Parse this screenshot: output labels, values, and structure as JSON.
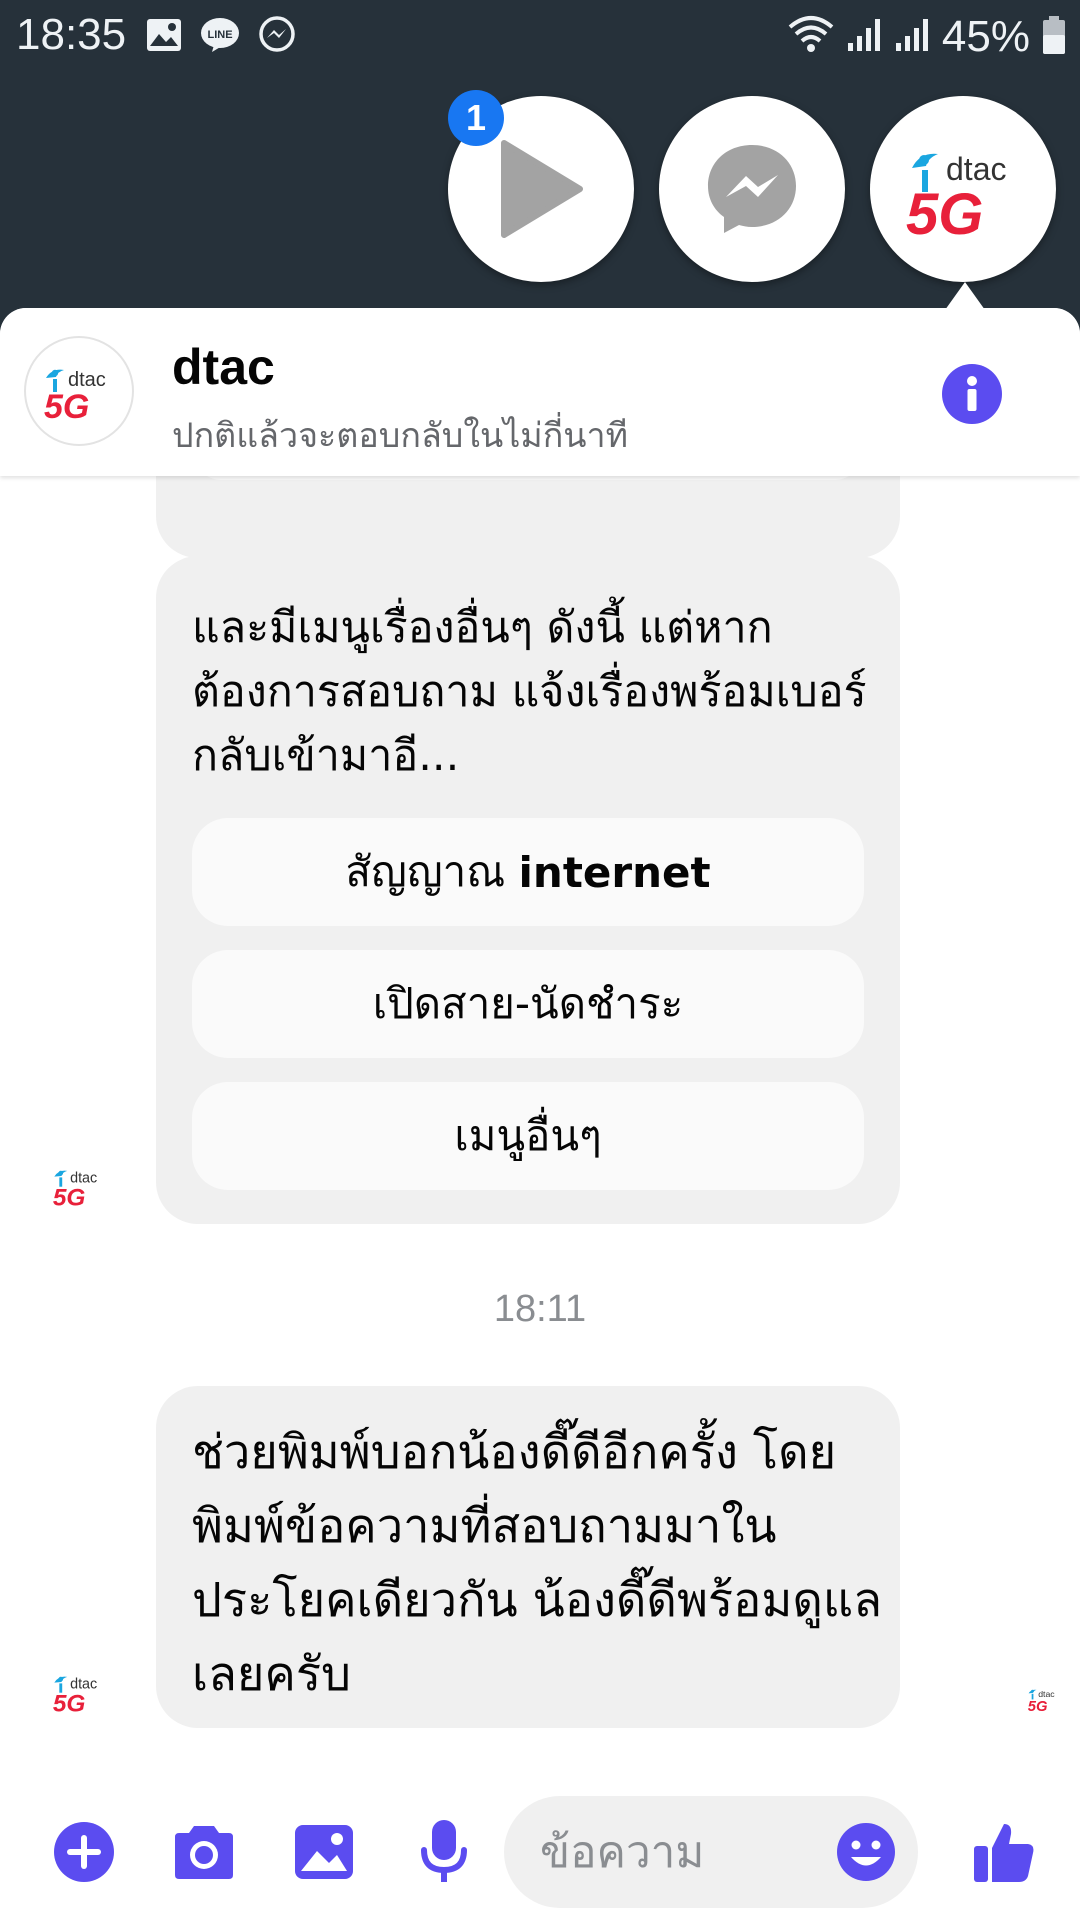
{
  "status_bar": {
    "time": "18:35",
    "left_icons": [
      "image-icon",
      "line-icon",
      "messenger-icon"
    ],
    "right_icons": [
      "wifi-icon",
      "signal-icon",
      "signal-icon"
    ],
    "battery_text": "45%"
  },
  "chat_heads": {
    "badge_count": "1",
    "items": [
      "play-icon",
      "messenger-icon",
      "dtac-5g-logo"
    ]
  },
  "logo": {
    "brand": "dtac",
    "tag": "5G"
  },
  "header": {
    "name": "dtac",
    "subtitle": "ปกติแล้วจะตอบกลับในไม่กี่นาที"
  },
  "messages": {
    "menu_bubble": {
      "text": "และมีเมนูเรื่องอื่นๆ ดังนี้ แต่หากต้องการสอบถาม แจ้งเรื่องพร้อมเบอร์กลับเข้ามาอี...",
      "buttons": [
        {
          "label_thai": "สัญญาณ ",
          "label_eng": "internet"
        },
        {
          "label": "เปิดสาย-นัดชำระ"
        },
        {
          "label": "เมนูอื่นๆ"
        }
      ]
    },
    "timestamp": "18:11",
    "help_bubble": {
      "text": "ช่วยพิมพ์บอกน้องดี๊ดีอีกครั้ง โดยพิมพ์ข้อความที่สอบถามมาในประโยคเดียวกัน น้องดี๊ดีพร้อมดูแลเลยครับ"
    }
  },
  "composer": {
    "placeholder": "ข้อความ"
  },
  "colors": {
    "accent": "#5b4cf0",
    "status_bar_bg": "#26313a",
    "bubble_bg": "#f0f0f0",
    "badge": "#1877f2"
  }
}
